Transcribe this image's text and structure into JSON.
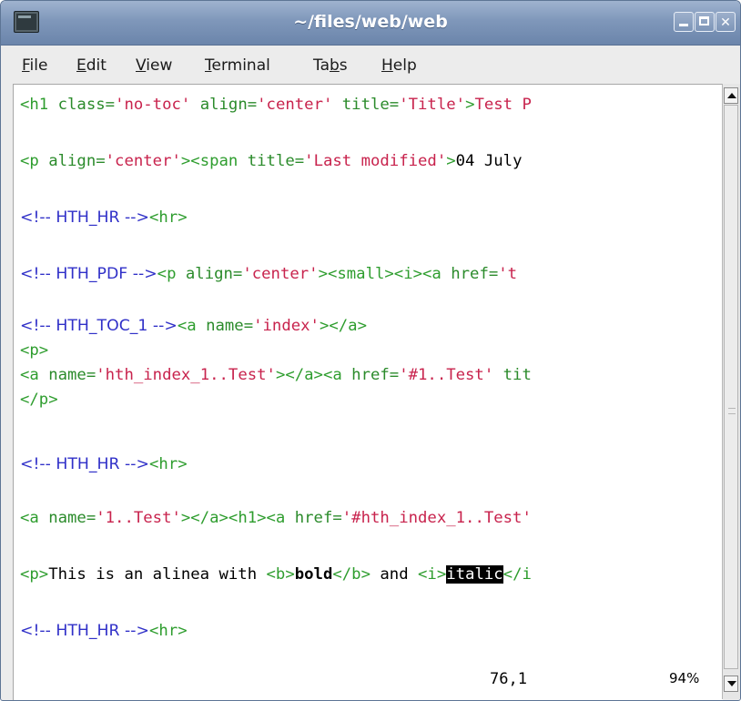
{
  "window": {
    "title": "~/files/web/web"
  },
  "menu": [
    {
      "pre": "",
      "u": "F",
      "post": "ile"
    },
    {
      "pre": "",
      "u": "E",
      "post": "dit"
    },
    {
      "pre": "",
      "u": "V",
      "post": "iew"
    },
    {
      "pre": "",
      "u": "T",
      "post": "erminal"
    },
    {
      "pre": "Ta",
      "u": "b",
      "post": "s"
    },
    {
      "pre": "",
      "u": "H",
      "post": "elp"
    }
  ],
  "lines": [
    {
      "segs": [
        {
          "t": "<h1 ",
          "c": "tag"
        },
        {
          "t": "class=",
          "c": "attr"
        },
        {
          "t": "'no-toc'",
          "c": "str"
        },
        {
          "t": " align=",
          "c": "attr"
        },
        {
          "t": "'center'",
          "c": "str"
        },
        {
          "t": " title=",
          "c": "attr"
        },
        {
          "t": "'Title'",
          "c": "str"
        },
        {
          "t": ">",
          "c": "tag"
        },
        {
          "t": "Test P",
          "c": "str"
        }
      ]
    },
    {
      "segs": [
        {
          "t": "<p ",
          "c": "tag"
        },
        {
          "t": "align=",
          "c": "attr"
        },
        {
          "t": "'center'",
          "c": "str"
        },
        {
          "t": "><span ",
          "c": "tag"
        },
        {
          "t": "title=",
          "c": "attr"
        },
        {
          "t": "'Last modified'",
          "c": "str"
        },
        {
          "t": ">",
          "c": "tag"
        },
        {
          "t": "04 July",
          "c": "txt"
        }
      ]
    },
    {
      "segs": [
        {
          "t": "<!-- HTH_HR -->",
          "c": "com"
        },
        {
          "t": "<hr>",
          "c": "tag"
        }
      ]
    },
    {
      "segs": [
        {
          "t": "<!-- HTH_PDF -->",
          "c": "com"
        },
        {
          "t": "<p ",
          "c": "tag"
        },
        {
          "t": "align=",
          "c": "attr"
        },
        {
          "t": "'center'",
          "c": "str"
        },
        {
          "t": "><small><i><a ",
          "c": "tag"
        },
        {
          "t": "href=",
          "c": "attr"
        },
        {
          "t": "'t",
          "c": "str"
        }
      ]
    },
    {
      "segs": [
        {
          "t": "<!-- HTH_TOC_1 -->",
          "c": "com"
        },
        {
          "t": "<a ",
          "c": "tag"
        },
        {
          "t": "name=",
          "c": "attr"
        },
        {
          "t": "'index'",
          "c": "str"
        },
        {
          "t": "></a>",
          "c": "tag"
        }
      ]
    },
    {
      "segs": [
        {
          "t": "<p>",
          "c": "tag"
        }
      ]
    },
    {
      "segs": [
        {
          "t": "<a ",
          "c": "tag"
        },
        {
          "t": "name=",
          "c": "attr"
        },
        {
          "t": "'hth_index_1..Test'",
          "c": "str"
        },
        {
          "t": "></a><a ",
          "c": "tag"
        },
        {
          "t": "href=",
          "c": "attr"
        },
        {
          "t": "'#1..Test'",
          "c": "str"
        },
        {
          "t": " tit",
          "c": "attr"
        }
      ]
    },
    {
      "segs": [
        {
          "t": "</p>",
          "c": "tag"
        }
      ]
    },
    {
      "segs": [
        {
          "t": "<!-- HTH_HR -->",
          "c": "com"
        },
        {
          "t": "<hr>",
          "c": "tag"
        }
      ]
    },
    {
      "segs": [
        {
          "t": "<a ",
          "c": "tag"
        },
        {
          "t": "name=",
          "c": "attr"
        },
        {
          "t": "'1..Test'",
          "c": "str"
        },
        {
          "t": "></a><h1><a ",
          "c": "tag"
        },
        {
          "t": "href=",
          "c": "attr"
        },
        {
          "t": "'#hth_index_1..Test'",
          "c": "str"
        }
      ]
    },
    {
      "segs": [
        {
          "t": "<p>",
          "c": "tag"
        },
        {
          "t": "This is an alinea with ",
          "c": "txt"
        },
        {
          "t": "<b>",
          "c": "tag"
        },
        {
          "t": "bold",
          "c": "bold"
        },
        {
          "t": "</b>",
          "c": "tag"
        },
        {
          "t": " and ",
          "c": "txt"
        },
        {
          "t": "<i>",
          "c": "tag"
        },
        {
          "t": "italic",
          "c": "sel"
        },
        {
          "t": "</i",
          "c": "tag"
        }
      ]
    },
    {
      "segs": [
        {
          "t": "<!-- HTH_HR -->",
          "c": "com"
        },
        {
          "t": "<hr>",
          "c": "tag"
        }
      ]
    }
  ],
  "status": {
    "position": "76,1",
    "percent": "94%"
  },
  "scroll_position": 0.94
}
